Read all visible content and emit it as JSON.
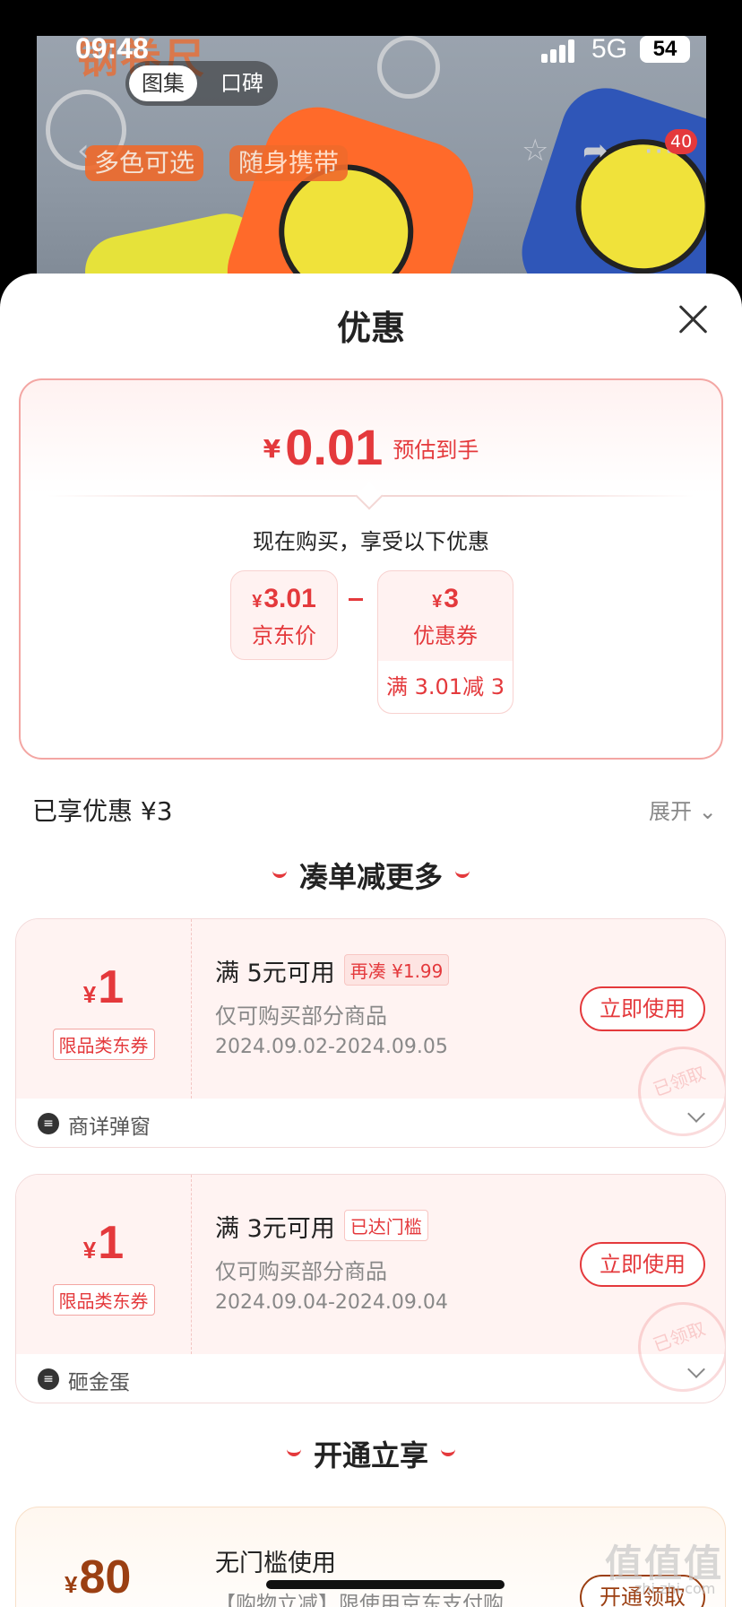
{
  "status_bar": {
    "time": "09:48",
    "network": "5G",
    "battery": "54"
  },
  "gallery": {
    "tabs": [
      "图集",
      "口碑"
    ],
    "ad_title": "钢卷尺",
    "tags": [
      "多色可选",
      "随身携带"
    ],
    "cart_badge": "40"
  },
  "sheet": {
    "title": "优惠",
    "summary": {
      "yen": "¥",
      "final_price": "0.01",
      "final_label": "预估到手",
      "buy_now_text": "现在购买，享受以下优惠",
      "jd_price_value": "3.01",
      "jd_price_label": "京东价",
      "coupon_value": "3",
      "coupon_label": "优惠券",
      "coupon_condition": "满 3.01减 3"
    },
    "enjoyed_text": "已享优惠 ¥3",
    "expand_text": "展开",
    "section_combine": "凑单减更多",
    "coupons": [
      {
        "amount": "1",
        "kind": "限品类东券",
        "condition": "满 5元可用",
        "tag": "再凑 ¥1.99",
        "scope": "仅可购买部分商品",
        "dates": "2024.09.02-2024.09.05",
        "button": "立即使用",
        "stamp": "已领取",
        "source": "商详弹窗"
      },
      {
        "amount": "1",
        "kind": "限品类东券",
        "condition": "满 3元可用",
        "tag": "已达门槛",
        "scope": "仅可购买部分商品",
        "dates": "2024.09.04-2024.09.04",
        "button": "立即使用",
        "stamp": "已领取",
        "source": "砸金蛋"
      }
    ],
    "section_vip": "开通立享",
    "vip_offer": {
      "amount": "80",
      "title": "无门槛使用",
      "desc": "【购物立减】限使用京东支付购",
      "button": "开通领取"
    }
  },
  "watermark": {
    "text": "值值值",
    "sub": "zhi.zhi.com"
  },
  "colors": {
    "accent": "#e4393c",
    "vip": "#9b3f12"
  }
}
